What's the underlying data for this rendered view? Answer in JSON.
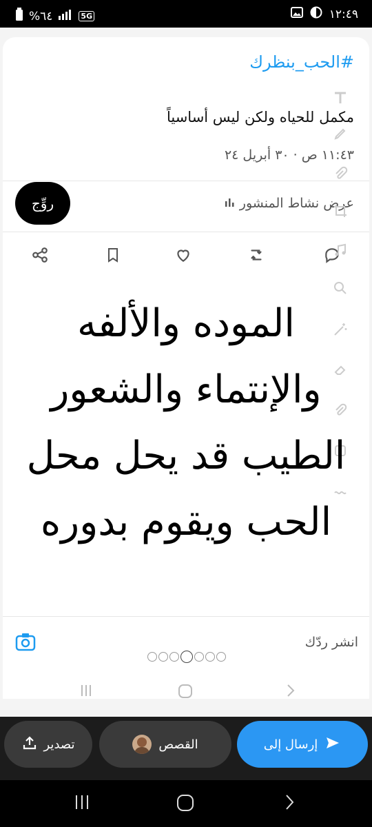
{
  "status_bar": {
    "time": "١٢:٤٩",
    "battery": "%٦٤",
    "network": "5G"
  },
  "post": {
    "hashtag": "#الحب_بنظرك",
    "text": "مكمل للحياه ولكن ليس أساسياً",
    "time": "١١:٤٣ ص · ٣٠ أبريل ٢٤",
    "activity_label": "عرض نشاط المنشور",
    "promote_label": "روِّج"
  },
  "overlay_text": "الموده والألفه والإنتماء والشعور الطيب قد يحل محل الحب ويقوم بدوره",
  "reply": {
    "placeholder": "انشر ردّك"
  },
  "share_sheet": {
    "send_label": "إرسال إلى",
    "stories_label": "القصص",
    "export_label": "تصدير"
  },
  "colors": {
    "accent": "#1d9bf0",
    "send_button": "#2b97f3",
    "dark_surface": "#1c1c1c"
  }
}
